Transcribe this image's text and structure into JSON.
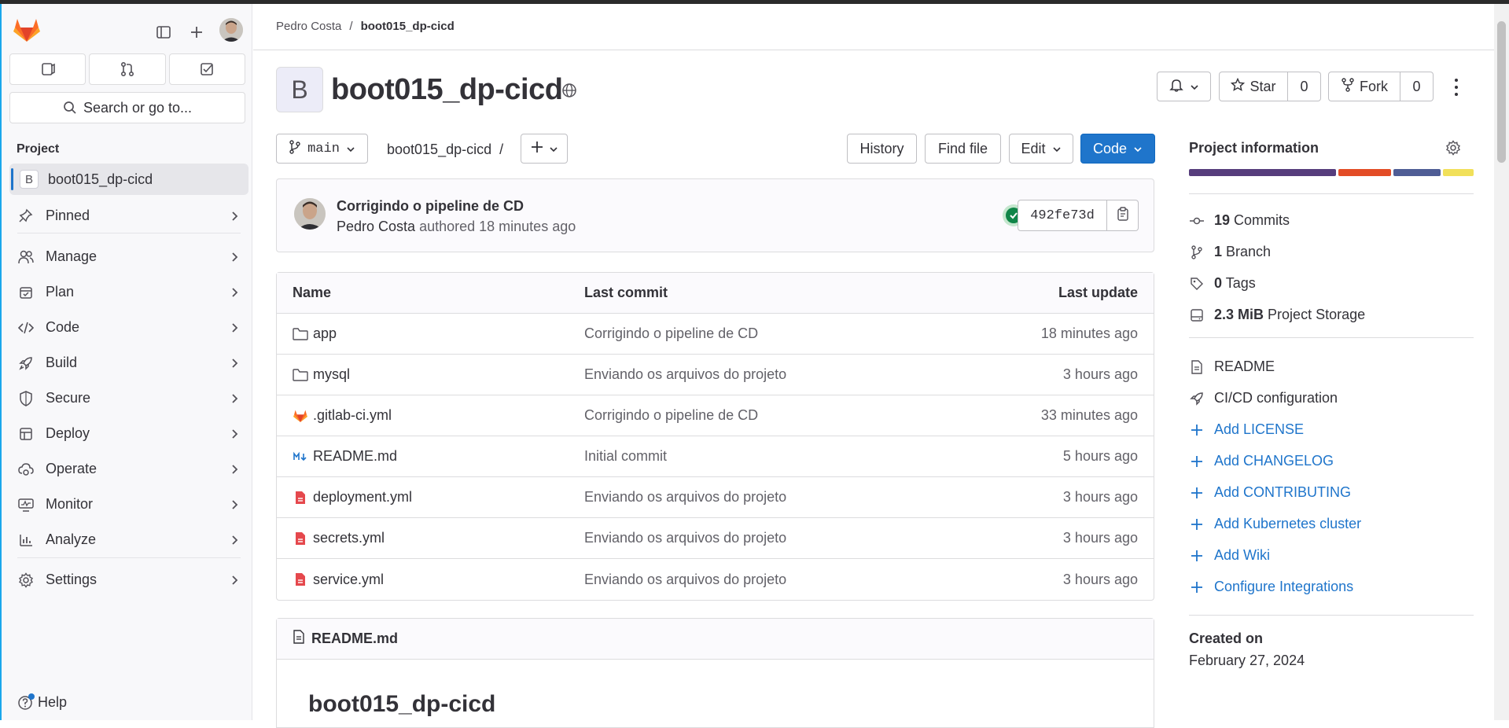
{
  "sidebar": {
    "search_label": "Search or go to...",
    "section": "Project",
    "project_letter": "B",
    "project_name": "boot015_dp-cicd",
    "items": [
      {
        "label": "Pinned",
        "icon": "pin-icon"
      },
      {
        "label": "Manage",
        "icon": "users-icon"
      },
      {
        "label": "Plan",
        "icon": "calendar-icon"
      },
      {
        "label": "Code",
        "icon": "code-icon"
      },
      {
        "label": "Build",
        "icon": "rocket-icon"
      },
      {
        "label": "Secure",
        "icon": "shield-icon"
      },
      {
        "label": "Deploy",
        "icon": "deployments-icon"
      },
      {
        "label": "Operate",
        "icon": "cloud-gear-icon"
      },
      {
        "label": "Monitor",
        "icon": "monitor-icon"
      },
      {
        "label": "Analyze",
        "icon": "chart-icon"
      },
      {
        "label": "Settings",
        "icon": "gear-icon"
      }
    ],
    "help_label": "Help"
  },
  "breadcrumb": {
    "parent": "Pedro Costa",
    "separator": "/",
    "current": "boot015_dp-cicd"
  },
  "project": {
    "avatar_letter": "B",
    "title": "boot015_dp-cicd",
    "star_label": "Star",
    "star_count": "0",
    "fork_label": "Fork",
    "fork_count": "0"
  },
  "toolbar": {
    "branch": "main",
    "path": "boot015_dp-cicd  /",
    "history_label": "History",
    "find_file_label": "Find file",
    "edit_label": "Edit",
    "code_label": "Code"
  },
  "commit": {
    "title": "Corrigindo o pipeline de CD",
    "author": "Pedro Costa",
    "meta": "authored 18 minutes ago",
    "sha": "492fe73d"
  },
  "files": {
    "headers": {
      "name": "Name",
      "last_commit": "Last commit",
      "last_update": "Last update"
    },
    "rows": [
      {
        "name": "app",
        "icon": "folder-icon",
        "commit": "Corrigindo o pipeline de CD",
        "updated": "18 minutes ago"
      },
      {
        "name": "mysql",
        "icon": "folder-icon",
        "commit": "Enviando os arquivos do projeto",
        "updated": "3 hours ago"
      },
      {
        "name": ".gitlab-ci.yml",
        "icon": "gitlab-file-icon",
        "commit": "Corrigindo o pipeline de CD",
        "updated": "33 minutes ago"
      },
      {
        "name": "README.md",
        "icon": "markdown-icon",
        "commit": "Initial commit",
        "updated": "5 hours ago"
      },
      {
        "name": "deployment.yml",
        "icon": "yaml-file-icon",
        "commit": "Enviando os arquivos do projeto",
        "updated": "3 hours ago"
      },
      {
        "name": "secrets.yml",
        "icon": "yaml-file-icon",
        "commit": "Enviando os arquivos do projeto",
        "updated": "3 hours ago"
      },
      {
        "name": "service.yml",
        "icon": "yaml-file-icon",
        "commit": "Enviando os arquivos do projeto",
        "updated": "3 hours ago"
      }
    ]
  },
  "readme": {
    "file": "README.md",
    "heading": "boot015_dp-cicd"
  },
  "info": {
    "title": "Project information",
    "language_colors": [
      "#563d7c",
      "#e34c26",
      "#4f5d95",
      "#f1e05a"
    ],
    "language_shares": [
      0.53,
      0.19,
      0.17,
      0.11
    ],
    "commits_count": "19",
    "commits_label": "Commits",
    "branch_count": "1",
    "branch_label": "Branch",
    "tags_count": "0",
    "tags_label": "Tags",
    "storage_size": "2.3 MiB",
    "storage_label": "Project Storage",
    "readme_label": "README",
    "cicd_label": "CI/CD configuration",
    "links": [
      "Add LICENSE",
      "Add CHANGELOG",
      "Add CONTRIBUTING",
      "Add Kubernetes cluster",
      "Add Wiki",
      "Configure Integrations"
    ],
    "created_label": "Created on",
    "created_date": "February 27, 2024"
  }
}
